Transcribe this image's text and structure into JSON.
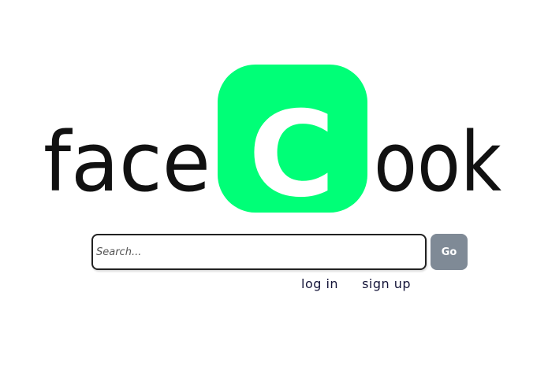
{
  "logo": {
    "text_left": "face",
    "badge_letter": "C",
    "text_right": "ook",
    "badge_color": "#00ff77",
    "badge_letter_color": "#ffffff",
    "text_color": "#111111"
  },
  "search": {
    "placeholder": "Search...",
    "value": "",
    "button_label": "Go",
    "button_color": "#7f8a96"
  },
  "auth": {
    "login_label": "log in",
    "signup_label": "sign up"
  }
}
